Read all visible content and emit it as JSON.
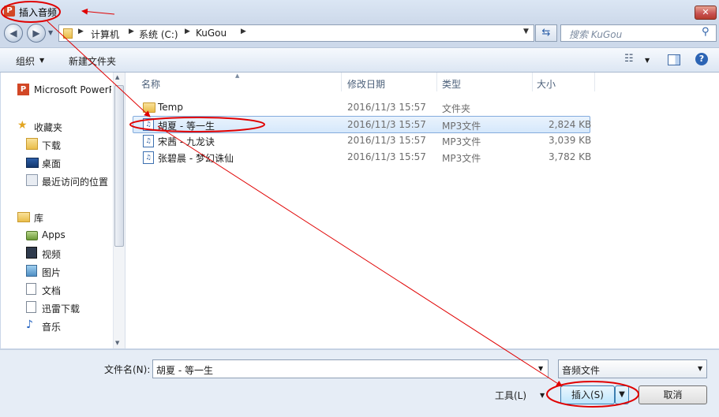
{
  "window": {
    "title": "插入音频",
    "app_icon": "P",
    "close_label": "✕"
  },
  "nav": {
    "back": "◀",
    "forward": "▶",
    "breadcrumb": [
      "计算机",
      "系统 (C:)",
      "KuGou"
    ],
    "search_placeholder": "搜索 KuGou"
  },
  "toolbar": {
    "organize": "组织",
    "new_folder": "新建文件夹"
  },
  "sidebar": {
    "top_item": "Microsoft PowerP",
    "favorites_header": "收藏夹",
    "favorites": [
      "下载",
      "桌面",
      "最近访问的位置"
    ],
    "libraries_header": "库",
    "libraries": [
      "Apps",
      "视频",
      "图片",
      "文档",
      "迅雷下载",
      "音乐"
    ]
  },
  "columns": {
    "name": "名称",
    "modified": "修改日期",
    "type": "类型",
    "size": "大小"
  },
  "files": [
    {
      "name": "Temp",
      "modified": "2016/11/3 15:57",
      "type": "文件夹",
      "size": "",
      "icon": "folder-icon"
    },
    {
      "name": "胡夏 - 等一生",
      "modified": "2016/11/3 15:57",
      "type": "MP3文件",
      "size": "2,824 KB",
      "icon": "mp3-icon",
      "selected": true
    },
    {
      "name": "宋茜 - 九龙诀",
      "modified": "2016/11/3 15:57",
      "type": "MP3文件",
      "size": "3,039 KB",
      "icon": "mp3-icon"
    },
    {
      "name": "张碧晨 - 梦幻诛仙",
      "modified": "2016/11/3 15:57",
      "type": "MP3文件",
      "size": "3,782 KB",
      "icon": "mp3-icon"
    }
  ],
  "footer": {
    "filename_label": "文件名(N):",
    "filename_value": "胡夏 - 等一生",
    "filetype_value": "音频文件",
    "tools_label": "工具(L)",
    "insert_label": "插入(S)",
    "cancel_label": "取消"
  },
  "annotation_color": "#e00000"
}
